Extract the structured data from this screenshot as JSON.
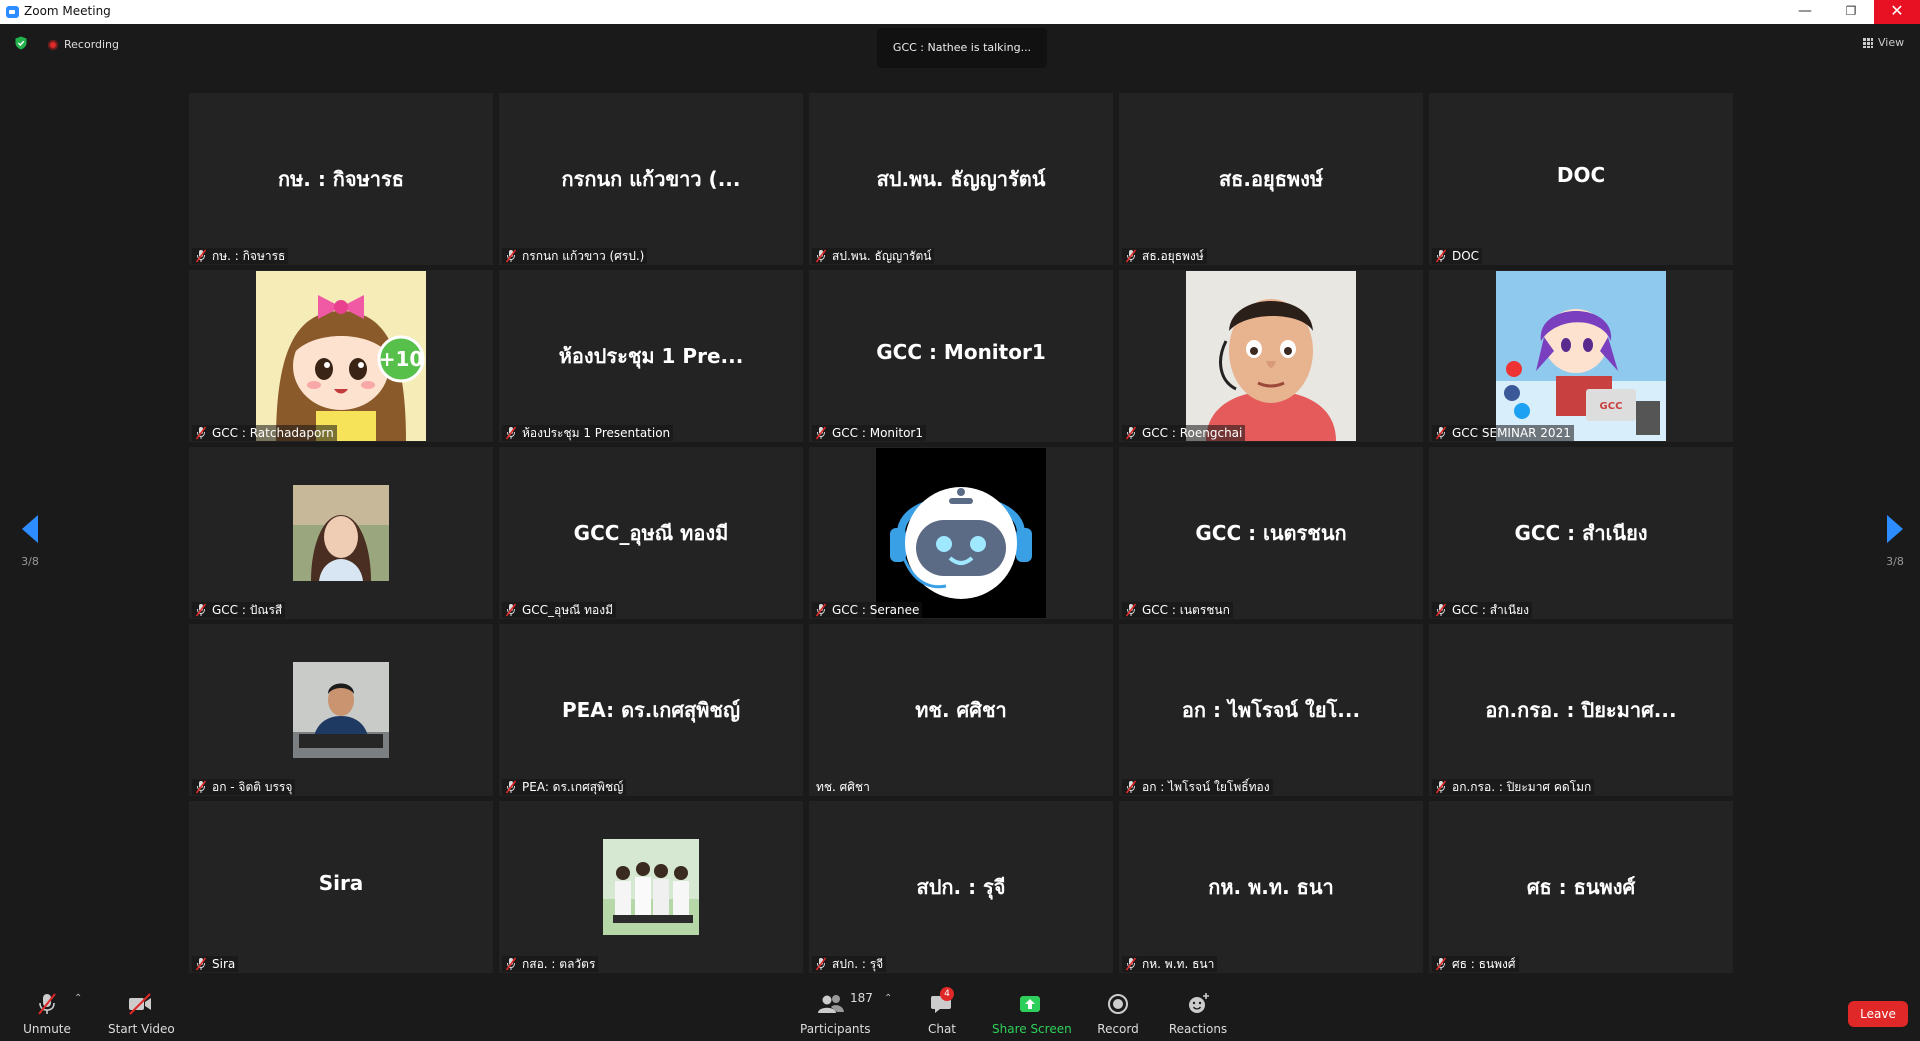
{
  "window": {
    "title": "Zoom Meeting"
  },
  "top": {
    "recording_label": "Recording",
    "talking": "GCC : Nathee is talking...",
    "view_label": "View"
  },
  "pager": {
    "prev_page": "3/8",
    "next_page": "3/8"
  },
  "tiles": [
    {
      "big": "กษ. : กิจษารธ",
      "name": "กษ. : กิจษารธ",
      "muted": true
    },
    {
      "big": "กรกนก แก้วขาว (...",
      "name": "กรกนก แก้วขาว (ศรป.)",
      "muted": true
    },
    {
      "big": "สป.พน. ธัญญารัตน์",
      "name": "สป.พน. ธัญญารัตน์",
      "muted": true
    },
    {
      "big": "สธ.อยุธพงษ์",
      "name": "สธ.อยุธพงษ์",
      "muted": true
    },
    {
      "big": "DOC",
      "name": "DOC",
      "muted": true
    },
    {
      "big": "",
      "name": "GCC : Ratchadaporn",
      "muted": true,
      "image": "cartoon-girl-avatar"
    },
    {
      "big": "ห้องประชุม 1 Pre...",
      "name": "ห้องประชุม 1 Presentation",
      "muted": true
    },
    {
      "big": "GCC : Monitor1",
      "name": "GCC : Monitor1",
      "muted": true
    },
    {
      "big": "",
      "name": "GCC : Roengchai",
      "muted": true,
      "image": "cartoon-man-avatar"
    },
    {
      "big": "",
      "name": "GCC SEMINAR 2021",
      "muted": true,
      "image": "seminar-avatar"
    },
    {
      "big": "",
      "name": "GCC : ปัณรสี",
      "muted": true,
      "image": "woman-photo"
    },
    {
      "big": "GCC_อุษณี ทองมี",
      "name": "GCC_อุษณี ทองมี",
      "muted": true
    },
    {
      "big": "",
      "name": "GCC : Seranee",
      "muted": true,
      "image": "robot-avatar"
    },
    {
      "big": "GCC : เนตรชนก",
      "name": "GCC : เนตรชนก",
      "muted": true
    },
    {
      "big": "GCC : สำเนียง",
      "name": "GCC : สำเนียง",
      "muted": true
    },
    {
      "big": "",
      "name": "อก - จิตติ บรรจุ",
      "muted": true,
      "image": "man-photo"
    },
    {
      "big": "PEA: ดร.เกศสุพิชญ์",
      "name": "PEA: ดร.เกศสุพิชญ์",
      "muted": true
    },
    {
      "big": "ทช. ศศิชา",
      "name": "ทช. ศศิชา",
      "muted": false
    },
    {
      "big": "อก : ไพโรจน์ ใยโ...",
      "name": "อก : ไพโรจน์ ใยโพธิ์ทอง",
      "muted": true
    },
    {
      "big": "อก.กรอ. : ปิยะมาศ...",
      "name": "อก.กรอ. : ปิยะมาศ คดโมก",
      "muted": true
    },
    {
      "big": "Sira",
      "name": "Sira",
      "muted": true
    },
    {
      "big": "",
      "name": "กสอ. : ตลวัตร",
      "muted": true,
      "image": "group-photo"
    },
    {
      "big": "สปก. : รุจี",
      "name": "สปก. : รุจี",
      "muted": true
    },
    {
      "big": "กห. พ.ท. ธนา",
      "name": "กห. พ.ท. ธนา",
      "muted": true
    },
    {
      "big": "ศธ : ธนพงศ์",
      "name": "ศธ : ธนพงศ์",
      "muted": true
    }
  ],
  "toolbar": {
    "unmute": "Unmute",
    "start_video": "Start Video",
    "participants": "Participants",
    "participant_count": "187",
    "chat": "Chat",
    "chat_badge": "4",
    "share_screen": "Share Screen",
    "record": "Record",
    "reactions": "Reactions",
    "leave": "Leave"
  },
  "colors": {
    "accent": "#2d8cff",
    "danger": "#e02828",
    "share_green": "#2dcf5a"
  }
}
